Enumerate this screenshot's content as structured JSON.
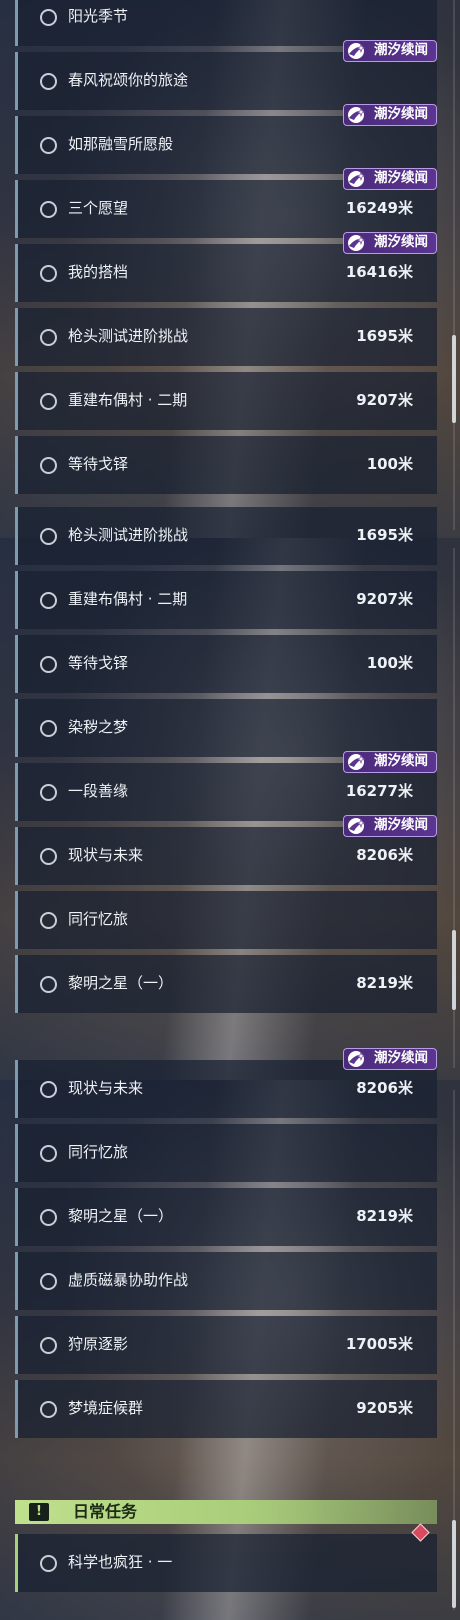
{
  "badge_label": "潮汐续闻",
  "unit_note": "米",
  "panels": [
    {
      "rows": [
        {
          "name": "阳光季节",
          "dist": "",
          "badge": false
        },
        {
          "name": "春风祝颂你的旅途",
          "dist": "",
          "badge": true
        },
        {
          "name": "如那融雪所愿般",
          "dist": "",
          "badge": true
        },
        {
          "name": "三个愿望",
          "dist": "16249米",
          "badge": true
        },
        {
          "name": "我的搭档",
          "dist": "16416米",
          "badge": true
        },
        {
          "name": "枪头测试进阶挑战",
          "dist": "1695米",
          "badge": false
        },
        {
          "name": "重建布偶村 · 二期",
          "dist": "9207米",
          "badge": false
        },
        {
          "name": "等待戈铎",
          "dist": "100米",
          "badge": false
        }
      ]
    },
    {
      "rows": [
        {
          "name": "枪头测试进阶挑战",
          "dist": "1695米",
          "badge": false
        },
        {
          "name": "重建布偶村 · 二期",
          "dist": "9207米",
          "badge": false
        },
        {
          "name": "等待戈铎",
          "dist": "100米",
          "badge": false
        },
        {
          "name": "染秽之梦",
          "dist": "",
          "badge": false
        },
        {
          "name": "一段善缘",
          "dist": "16277米",
          "badge": true
        },
        {
          "name": "现状与未来",
          "dist": "8206米",
          "badge": true
        },
        {
          "name": "同行忆旅",
          "dist": "",
          "badge": false
        },
        {
          "name": "黎明之星（一）",
          "dist": "8219米",
          "badge": false
        }
      ]
    },
    {
      "rows": [
        {
          "name": "现状与未来",
          "dist": "8206米",
          "badge": true
        },
        {
          "name": "同行忆旅",
          "dist": "",
          "badge": false
        },
        {
          "name": "黎明之星（一）",
          "dist": "8219米",
          "badge": false
        },
        {
          "name": "虚质磁暴协助作战",
          "dist": "",
          "badge": false
        },
        {
          "name": "狩原逐影",
          "dist": "17005米",
          "badge": false
        },
        {
          "name": "梦境症候群",
          "dist": "9205米",
          "badge": false
        }
      ]
    }
  ],
  "daily": {
    "header_title": "日常任务",
    "header_icon": "!",
    "header_tag": "",
    "rows": [
      {
        "name": "科学也疯狂 · 一",
        "dist": ""
      }
    ]
  },
  "colors": {
    "badge_bg": "#4a2a7a",
    "badge_border": "#b79ae8",
    "daily_accent": "#bfe08c",
    "row_bar": "#7e9bb0",
    "red_marker": "#d94a5e"
  }
}
